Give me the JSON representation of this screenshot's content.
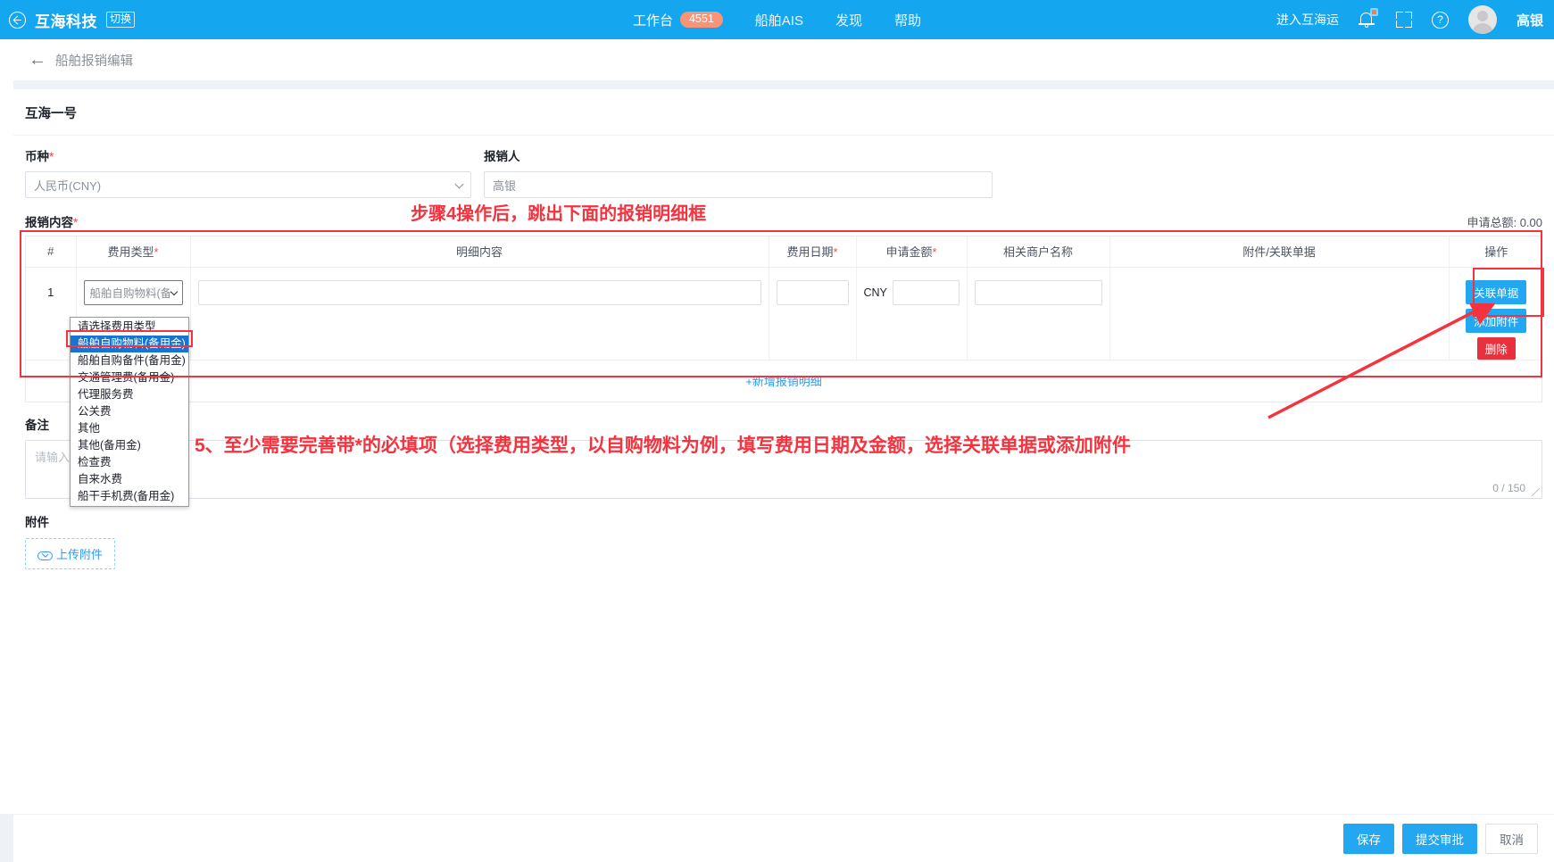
{
  "topbar": {
    "back_icon": "circle-back-icon",
    "brand": "互海科技",
    "switch_label": "切换",
    "nav": [
      {
        "label": "工作台",
        "badge": "4551"
      },
      {
        "label": "船舶AIS",
        "badge": ""
      },
      {
        "label": "发现",
        "badge": ""
      },
      {
        "label": "帮助",
        "badge": ""
      }
    ],
    "enter_link": "进入互海运",
    "bell_icon": "bell-icon",
    "fullscreen_icon": "fullscreen-icon",
    "help_icon": "question-mark-icon",
    "avatar_icon": "avatar-icon",
    "user_name": "高银"
  },
  "breadcrumb": {
    "back_arrow": "←",
    "title": "船舶报销编辑"
  },
  "card": {
    "ship_name": "互海一号",
    "currency": {
      "label": "币种",
      "required": "*",
      "value": "人民币(CNY)"
    },
    "applicant": {
      "label": "报销人",
      "required": "",
      "value": "高银"
    }
  },
  "reimbursement": {
    "label": "报销内容",
    "required": "*",
    "total_label": "申请总额: 0.00",
    "columns": [
      "#",
      "费用类型",
      "明细内容",
      "费用日期",
      "申请金额",
      "相关商户名称",
      "附件/关联单据",
      "操作"
    ],
    "columns_required": [
      "",
      "*",
      "",
      "*",
      "*",
      "",
      "",
      ""
    ],
    "rows": [
      {
        "index": "1",
        "expense_type": "船舶自购物料(备",
        "detail": "",
        "date": "",
        "currency_code": "CNY",
        "amount": "",
        "merchant": "",
        "attachment": "",
        "op_link_doc": "关联单据",
        "op_add_attach": "添加附件",
        "op_delete": "删除"
      }
    ],
    "add_row_label": "+新增报销明细"
  },
  "expense_type_dropdown": {
    "open": true,
    "options": [
      "请选择费用类型",
      "船舶自购物料(备用金)",
      "船舶自购备件(备用金)",
      "交通管理费(备用金)",
      "代理服务费",
      "公关费",
      "其他",
      "其他(备用金)",
      "检查费",
      "自来水费",
      "船干手机费(备用金)"
    ],
    "selected_index": 1
  },
  "remarks": {
    "label": "备注",
    "placeholder": "请输入备注",
    "counter": "0 / 150"
  },
  "attachment": {
    "label": "附件",
    "upload_label": "上传附件",
    "upload_icon": "cloud-upload-icon"
  },
  "footer": {
    "save": "保存",
    "submit": "提交审批",
    "cancel": "取消"
  },
  "annotations": {
    "step4": "步骤4操作后，跳出下面的报销明细框",
    "step5": "5、至少需要完善带*的必填项（选择费用类型，以自购物料为例，填写费用日期及金额，选择关联单据或添加附件",
    "color": "#f5333f"
  }
}
